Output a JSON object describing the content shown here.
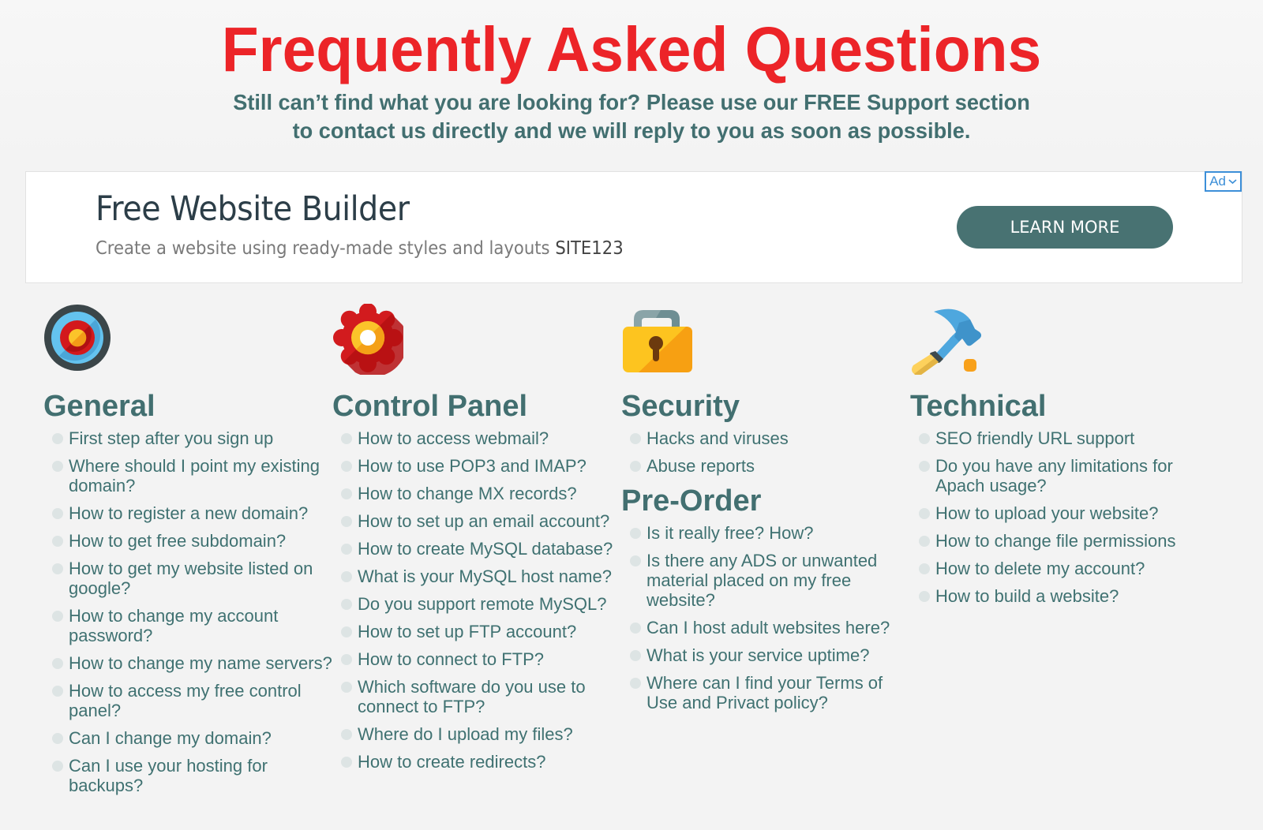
{
  "header": {
    "title": "Frequently Asked Questions",
    "subtitle_line1": "Still can’t find what you are looking for? Please use our FREE Support section",
    "subtitle_line2": "to contact us directly and we will reply to you as soon as possible."
  },
  "ad": {
    "title": "Free Website Builder",
    "description": "Create a website using ready-made styles and layouts",
    "brand": "SITE123",
    "cta_label": "LEARN MORE",
    "badge_label": "Ad",
    "badge_icon": "chevron-down-icon",
    "cta_color": "#487272",
    "badge_color": "#3c8fd8"
  },
  "colors": {
    "title": "#ec2428",
    "text": "#426f70",
    "bullet": "#dde4e4"
  },
  "columns": [
    {
      "icon": "target-icon",
      "sections": [
        {
          "title": "General",
          "items": [
            "First step after you sign up",
            "Where should I point my existing domain?",
            "How to register a new domain?",
            "How to get free subdomain?",
            "How to get my website listed on google?",
            "How to change my account password?",
            "How to change my name servers?",
            "How to access my free control panel?",
            "Can I change my domain?",
            "Can I use your hosting for backups?"
          ]
        }
      ]
    },
    {
      "icon": "gear-icon",
      "sections": [
        {
          "title": "Control Panel",
          "items": [
            "How to access webmail?",
            "How to use POP3 and IMAP?",
            "How to change MX records?",
            "How to set up an email account?",
            "How to create MySQL database?",
            "What is your MySQL host name?",
            "Do you support remote MySQL?",
            "How to set up FTP account?",
            "How to connect to FTP?",
            "Which software do you use to connect to FTP?",
            "Where do I upload my files?",
            "How to create redirects?"
          ]
        }
      ]
    },
    {
      "icon": "padlock-icon",
      "sections": [
        {
          "title": "Security",
          "items": [
            "Hacks and viruses",
            "Abuse reports"
          ]
        },
        {
          "title": "Pre-Order",
          "items": [
            "Is it really free? How?",
            "Is there any ADS or unwanted material placed on my free website?",
            "Can I host adult websites here?",
            "What is your service uptime?",
            "Where can I find your Terms of Use and Privact policy?"
          ]
        }
      ]
    },
    {
      "icon": "hammer-icon",
      "sections": [
        {
          "title": "Technical",
          "items": [
            "SEO friendly URL support",
            "Do you have any limitations for Apach usage?",
            "How to upload your website?",
            "How to change file permissions",
            "How to delete my account?",
            "How to build a website?"
          ]
        }
      ]
    }
  ]
}
